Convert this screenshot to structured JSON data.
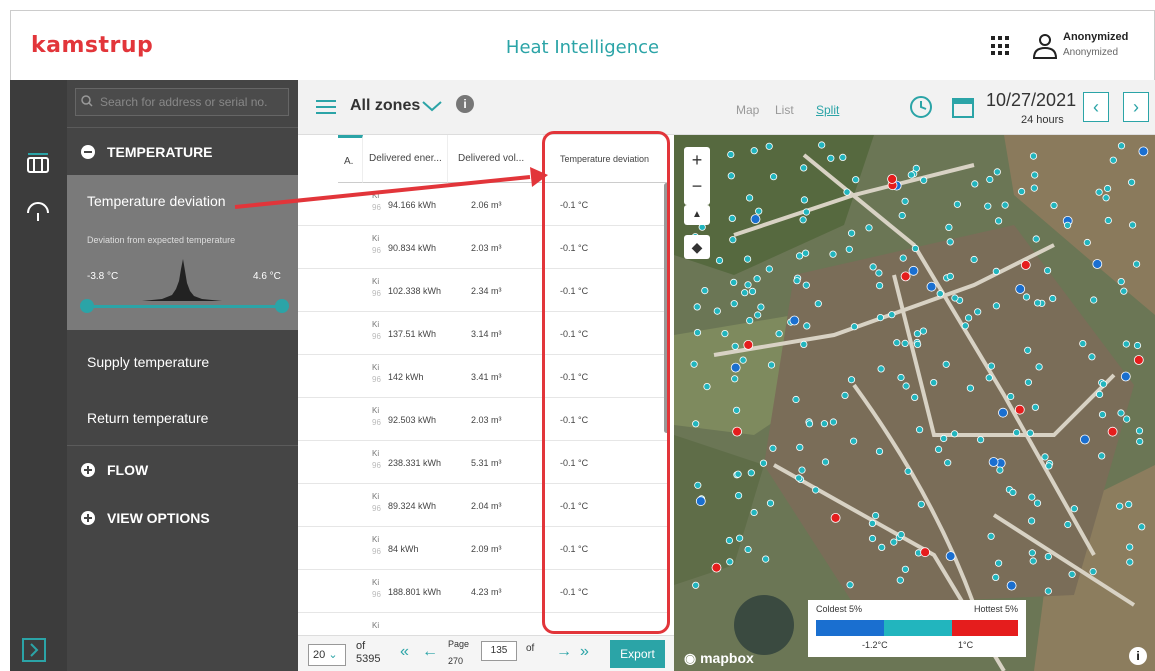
{
  "header": {
    "logo": "kamstrup",
    "title": "Heat Intelligence",
    "user_name": "Anonymized",
    "user_org": "Anonymized"
  },
  "sidebar": {
    "search_placeholder": "Search for address or serial no.",
    "temperature_section": "TEMPERATURE",
    "selected_item": {
      "title": "Temperature deviation",
      "subtitle": "Deviation from expected temperature",
      "min_label": "-3.8 °C",
      "max_label": "4.6 °C"
    },
    "items": [
      "Supply temperature",
      "Return temperature"
    ],
    "flow_section": "FLOW",
    "view_options_section": "VIEW OPTIONS"
  },
  "toolbar": {
    "zones": "All zones",
    "view_tabs": [
      "Map",
      "List",
      "Split"
    ],
    "active_tab": "Split",
    "date": "10/27/2021",
    "period": "24 hours"
  },
  "table": {
    "headers": [
      "A.",
      "Delivered ener...",
      "Delivered vol...",
      "Temperature deviation"
    ],
    "rows": [
      {
        "a1": "Ki",
        "a2": "96",
        "energy": "94.166 kWh",
        "volume": "2.06 m³",
        "deviation": "-0.1 °C"
      },
      {
        "a1": "Ki",
        "a2": "96",
        "energy": "90.834 kWh",
        "volume": "2.03 m³",
        "deviation": "-0.1 °C"
      },
      {
        "a1": "Ki",
        "a2": "96",
        "energy": "102.338 kWh",
        "volume": "2.34 m³",
        "deviation": "-0.1 °C"
      },
      {
        "a1": "Ki",
        "a2": "96",
        "energy": "137.51 kWh",
        "volume": "3.14 m³",
        "deviation": "-0.1 °C"
      },
      {
        "a1": "Ki",
        "a2": "96",
        "energy": "142 kWh",
        "volume": "3.41 m³",
        "deviation": "-0.1 °C"
      },
      {
        "a1": "Ki",
        "a2": "96",
        "energy": "92.503 kWh",
        "volume": "2.03 m³",
        "deviation": "-0.1 °C"
      },
      {
        "a1": "Ki",
        "a2": "96",
        "energy": "238.331 kWh",
        "volume": "5.31 m³",
        "deviation": "-0.1 °C"
      },
      {
        "a1": "Ki",
        "a2": "96",
        "energy": "89.324 kWh",
        "volume": "2.04 m³",
        "deviation": "-0.1 °C"
      },
      {
        "a1": "Ki",
        "a2": "96",
        "energy": "84 kWh",
        "volume": "2.09 m³",
        "deviation": "-0.1 °C"
      },
      {
        "a1": "Ki",
        "a2": "96",
        "energy": "188.801 kWh",
        "volume": "4.23 m³",
        "deviation": "-0.1 °C"
      },
      {
        "a1": "Ki",
        "a2": "",
        "energy": "",
        "volume": "",
        "deviation": ""
      }
    ]
  },
  "pagination": {
    "page_size": "20",
    "of_label": "of",
    "total": "5395",
    "page_label": "Page",
    "page": "135",
    "pages_of": "of",
    "total_pages": "270",
    "export": "Export"
  },
  "map": {
    "legend_coldest": "Coldest 5%",
    "legend_hottest": "Hottest 5%",
    "legend_min": "-1.2°C",
    "legend_max": "1°C",
    "attribution": "mapbox",
    "colors": {
      "cold": "#1a6fd0",
      "mid": "#22b5be",
      "hot": "#e51d1d"
    }
  }
}
